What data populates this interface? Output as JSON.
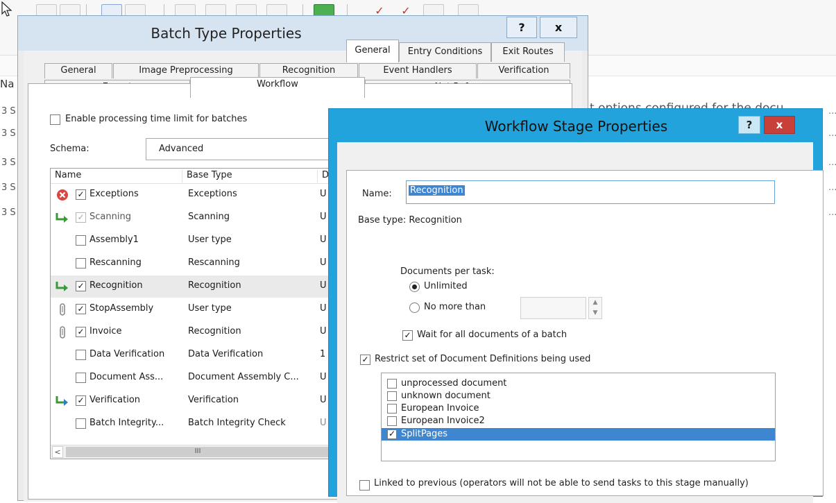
{
  "batch_dialog": {
    "title": "Batch Type Properties",
    "help_label": "?",
    "close_label": "x",
    "tabs_row1": [
      "General",
      "Image Preprocessing",
      "Recognition",
      "Event Handlers",
      "Verification"
    ],
    "tabs_row2": [
      "Export",
      "Workflow",
      ".Net References"
    ],
    "active_tab": "Workflow",
    "time_limit_label": "Enable processing time limit for batches",
    "schema_label": "Schema:",
    "schema_value": "Advanced",
    "list_headers": [
      "Name",
      "Base Type",
      "D"
    ],
    "stages": [
      {
        "name": "Exceptions",
        "base_type": "Exceptions",
        "d": "U",
        "checked": true,
        "icon": "error-icon"
      },
      {
        "name": "Scanning",
        "base_type": "Scanning",
        "d": "U",
        "checked": true,
        "grey": true,
        "icon": "route-arrow-icon"
      },
      {
        "name": "Assembly1",
        "base_type": "User type",
        "d": "U",
        "checked": false,
        "icon": ""
      },
      {
        "name": "Rescanning",
        "base_type": "Rescanning",
        "d": "U",
        "checked": false,
        "icon": ""
      },
      {
        "name": "Recognition",
        "base_type": "Recognition",
        "d": "U",
        "checked": true,
        "icon": "route-arrow-icon",
        "selected": true
      },
      {
        "name": "StopAssembly",
        "base_type": "User type",
        "d": "U",
        "checked": true,
        "icon": "clip-icon"
      },
      {
        "name": "Invoice",
        "base_type": "Recognition",
        "d": "U",
        "checked": true,
        "icon": "clip-icon"
      },
      {
        "name": "Data Verification",
        "base_type": "Data Verification",
        "d": "1",
        "checked": false,
        "icon": ""
      },
      {
        "name": "Document Ass...",
        "base_type": "Document Assembly C...",
        "d": "U",
        "checked": false,
        "icon": ""
      },
      {
        "name": "Verification",
        "base_type": "Verification",
        "d": "U",
        "checked": true,
        "icon": "route-back-arrow-icon"
      },
      {
        "name": "Batch Integrity...",
        "base_type": "Batch Integrity Check",
        "d": "U",
        "checked": false,
        "icon": ""
      }
    ],
    "scroll_left": "<",
    "scroll_thumb": "III"
  },
  "stage_dialog": {
    "title": "Workflow Stage Properties",
    "help_label": "?",
    "close_label": "x",
    "tabs": [
      "General",
      "Entry Conditions",
      "Exit Routes"
    ],
    "active_tab": "General",
    "name_label": "Name:",
    "name_value": "Recognition",
    "base_type_text": "Base type: Recognition",
    "docs_per_task_label": "Documents per task:",
    "unlimited_label": "Unlimited",
    "no_more_than_label": "No more than",
    "wait_label": "Wait for all documents of a batch",
    "restrict_label": "Restrict set of Document Definitions being used",
    "document_definitions": [
      {
        "label": "unprocessed document",
        "checked": false
      },
      {
        "label": "unknown document",
        "checked": false
      },
      {
        "label": "European Invoice",
        "checked": false
      },
      {
        "label": "European Invoice2",
        "checked": false
      },
      {
        "label": "SplitPages",
        "checked": true,
        "selected": true
      }
    ],
    "linked_label": "Linked to previous (operators will not be able to send tasks to this stage manually)"
  },
  "background": {
    "left_label": "Na",
    "row_text": "t options configured for the docu",
    "row_glyph": "3 S",
    "ellipsis": "..."
  },
  "colors": {
    "accent_blue": "#22a3dc",
    "selection_blue": "#3f86d0",
    "close_red": "#c7413a"
  }
}
